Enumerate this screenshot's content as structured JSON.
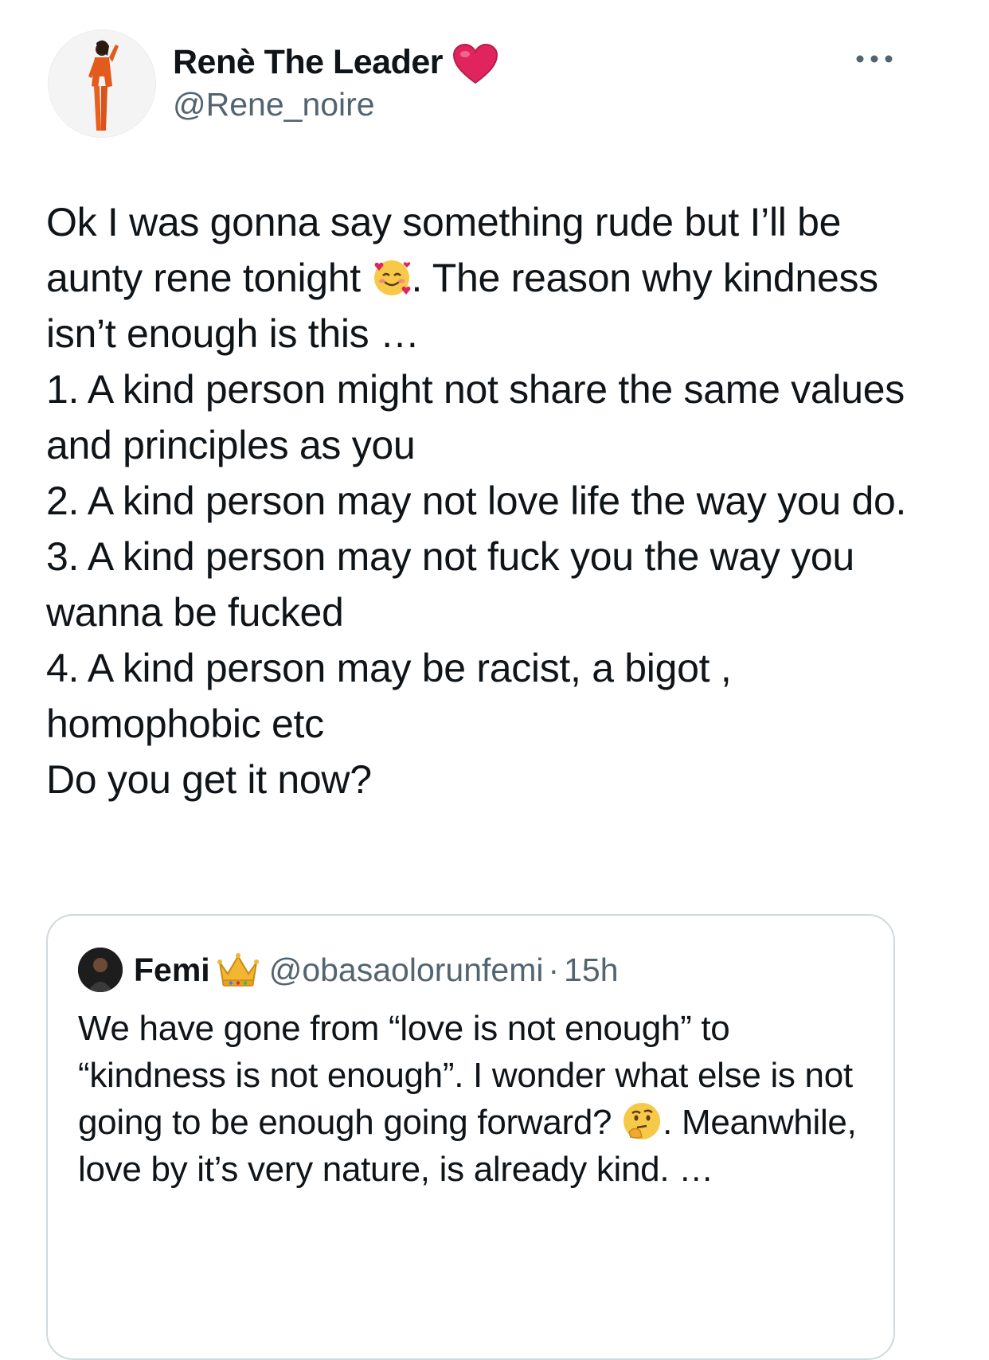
{
  "tweet": {
    "author": {
      "display_name": "Renè The Leader",
      "badge_icon": "red-heart-icon",
      "handle": "@Rene_noire"
    },
    "more_icon": "more-horizontal-icon",
    "text_part1": "Ok I was gonna say something rude but I’ll be aunty rene tonight ",
    "emoji1": "smiling-face-with-hearts-icon",
    "text_part2": ". The reason why kindness isn’t enough is this …\n1. A kind person might not share the same values and principles as you\n2. A kind person may not love life the way you do.\n3. A kind person may not fuck you the way you wanna be fucked\n4. A kind person may be racist, a bigot , homophobic etc\nDo you get it now?"
  },
  "quoted_tweet": {
    "author": {
      "name": "Femi",
      "badge_icon": "crown-icon",
      "handle": "@obasaolorunfemi",
      "separator": "·",
      "time": "15h"
    },
    "text_part1": "We have gone from “love is not enough” to “kindness is not enough”. I wonder what else is not going to be enough going forward? ",
    "emoji": "thinking-face-icon",
    "text_part2": ". Meanwhile, love by it’s very nature, is already kind. …"
  },
  "colors": {
    "text_primary": "#0f1419",
    "text_secondary": "#536471",
    "border": "#cfd9de",
    "heart": "#e0245e"
  }
}
